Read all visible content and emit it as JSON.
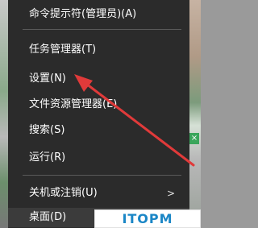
{
  "menu": {
    "items": [
      {
        "label": "命令提示符(管理员)(A)"
      },
      {
        "label": "任务管理器(T)"
      },
      {
        "label": "设置(N)"
      },
      {
        "label": "文件资源管理器(E)"
      },
      {
        "label": "搜索(S)"
      },
      {
        "label": "运行(R)"
      },
      {
        "label": "关机或注销(U)"
      },
      {
        "label": "桌面(D)"
      }
    ],
    "submenu_glyph": ">"
  },
  "colors": {
    "menu_background": "#2b2b2b",
    "menu_text": "#ffffff",
    "annotation_arrow": "#e03a3a",
    "watermark_text": "#1a86c6"
  },
  "watermark": {
    "text": "ITOPM"
  },
  "annotation": {
    "icon": "red-arrow-icon"
  }
}
